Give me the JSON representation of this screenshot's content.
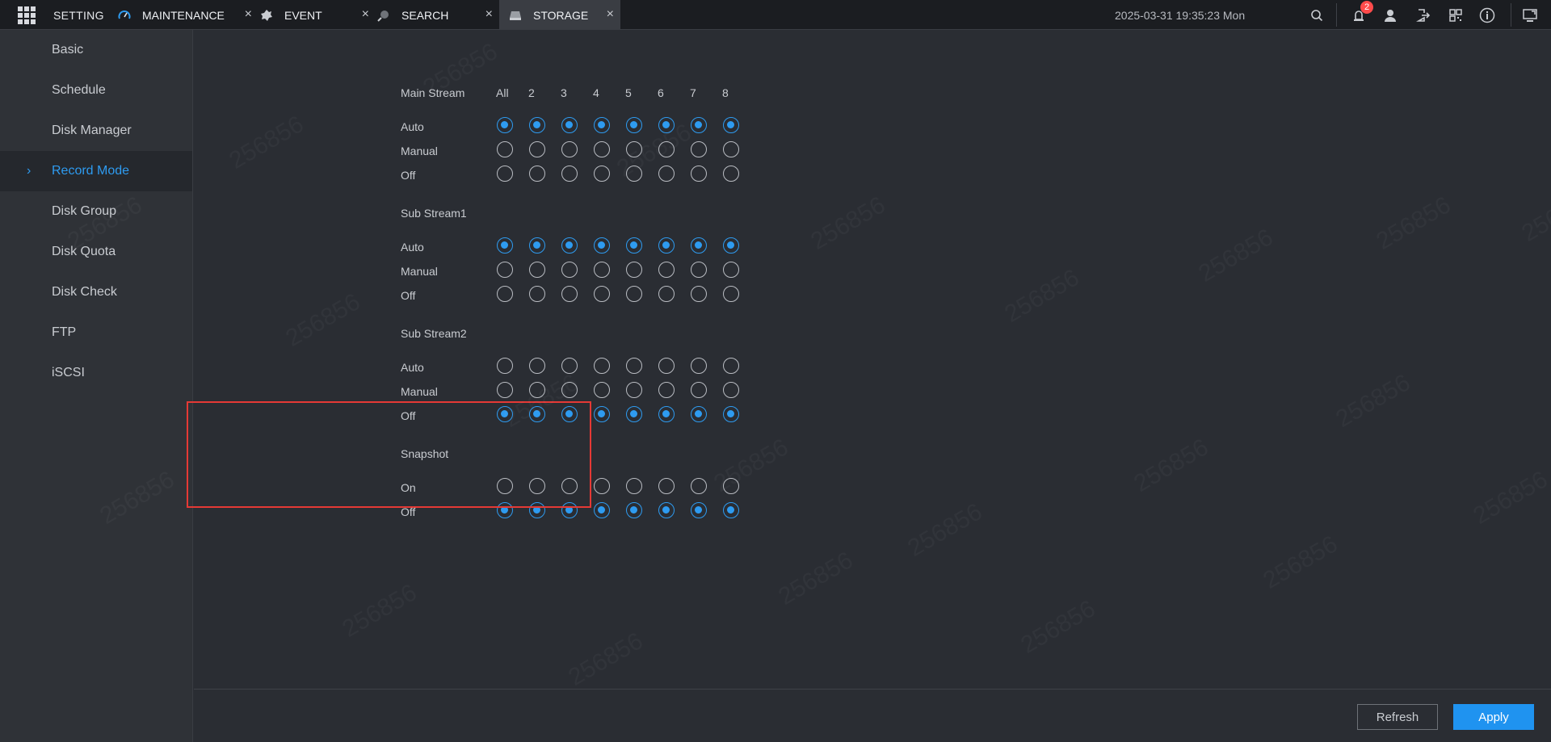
{
  "topbar": {
    "setting_label": "SETTING",
    "datetime": "2025-03-31 19:35:23 Mon",
    "alarm_badge": "2",
    "tabs": [
      {
        "label": "MAINTENANCE",
        "icon": "gauge-icon",
        "active": false
      },
      {
        "label": "EVENT",
        "icon": "event-icon",
        "active": false
      },
      {
        "label": "SEARCH",
        "icon": "search-tab-icon",
        "active": false
      },
      {
        "label": "STORAGE",
        "icon": "storage-icon",
        "active": true
      }
    ],
    "close_glyph": "×"
  },
  "sidebar": {
    "items": [
      {
        "label": "Basic"
      },
      {
        "label": "Schedule"
      },
      {
        "label": "Disk Manager"
      },
      {
        "label": "Record Mode",
        "active": true
      },
      {
        "label": "Disk Group"
      },
      {
        "label": "Disk Quota"
      },
      {
        "label": "Disk Check"
      },
      {
        "label": "FTP"
      },
      {
        "label": "iSCSI"
      }
    ]
  },
  "record_mode": {
    "channel_headers": [
      "All",
      "2",
      "3",
      "4",
      "5",
      "6",
      "7",
      "8"
    ],
    "sections": [
      {
        "title": "Main Stream",
        "rows": [
          {
            "label": "Auto",
            "selected": [
              true,
              true,
              true,
              true,
              true,
              true,
              true,
              true
            ]
          },
          {
            "label": "Manual",
            "selected": [
              false,
              false,
              false,
              false,
              false,
              false,
              false,
              false
            ]
          },
          {
            "label": "Off",
            "selected": [
              false,
              false,
              false,
              false,
              false,
              false,
              false,
              false
            ]
          }
        ]
      },
      {
        "title": "Sub Stream1",
        "rows": [
          {
            "label": "Auto",
            "selected": [
              true,
              true,
              true,
              true,
              true,
              true,
              true,
              true
            ]
          },
          {
            "label": "Manual",
            "selected": [
              false,
              false,
              false,
              false,
              false,
              false,
              false,
              false
            ]
          },
          {
            "label": "Off",
            "selected": [
              false,
              false,
              false,
              false,
              false,
              false,
              false,
              false
            ]
          }
        ]
      },
      {
        "title": "Sub Stream2",
        "rows": [
          {
            "label": "Auto",
            "selected": [
              false,
              false,
              false,
              false,
              false,
              false,
              false,
              false
            ]
          },
          {
            "label": "Manual",
            "selected": [
              false,
              false,
              false,
              false,
              false,
              false,
              false,
              false
            ]
          },
          {
            "label": "Off",
            "selected": [
              true,
              true,
              true,
              true,
              true,
              true,
              true,
              true
            ]
          }
        ]
      },
      {
        "title": "Snapshot",
        "rows": [
          {
            "label": "On",
            "selected": [
              false,
              false,
              false,
              false,
              false,
              false,
              false,
              false
            ]
          },
          {
            "label": "Off",
            "selected": [
              true,
              true,
              true,
              true,
              true,
              true,
              true,
              true
            ]
          }
        ]
      }
    ]
  },
  "footer": {
    "refresh_label": "Refresh",
    "apply_label": "Apply"
  },
  "watermark_text": "256856",
  "colors": {
    "accent": "#2e9bf0",
    "apply_button": "#1f93f0",
    "highlight_border": "#e53935",
    "badge": "#ff4b4b"
  }
}
